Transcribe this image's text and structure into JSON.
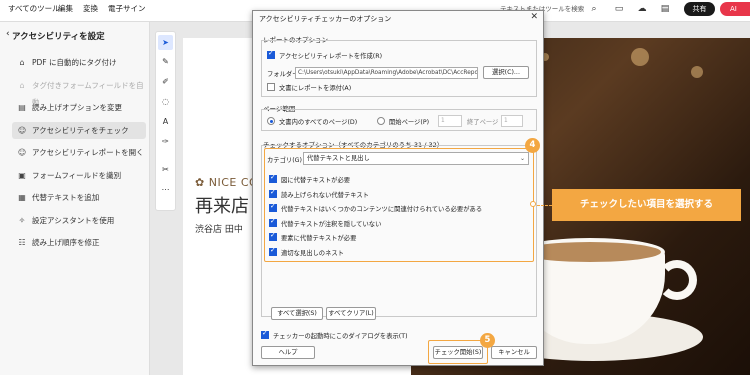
{
  "topbar": {
    "menus": [
      "すべてのツール",
      "編集",
      "変換",
      "電子サイン"
    ],
    "search_placeholder": "テキストまたはツールを検索",
    "share_label": "共有",
    "ai_label": "AI"
  },
  "leftpanel": {
    "title": "アクセシビリティを設定",
    "items": [
      {
        "label": "PDF に自動的にタグ付け",
        "icon": "tag-icon",
        "glyph": "⌂",
        "disabled": false,
        "active": false
      },
      {
        "label": "タグ付きフォームフィールドを自動",
        "icon": "form-tag-icon",
        "glyph": "⌂",
        "disabled": true,
        "active": false
      },
      {
        "label": "読み上げオプションを変更",
        "icon": "read-aloud-icon",
        "glyph": "▤",
        "disabled": false,
        "active": false
      },
      {
        "label": "アクセシビリティをチェック",
        "icon": "accessibility-check-icon",
        "glyph": "☺",
        "disabled": false,
        "active": true
      },
      {
        "label": "アクセシビリティレポートを開く",
        "icon": "report-icon",
        "glyph": "☺",
        "disabled": false,
        "active": false
      },
      {
        "label": "フォームフィールドを識別",
        "icon": "form-field-icon",
        "glyph": "▣",
        "disabled": false,
        "active": false
      },
      {
        "label": "代替テキストを追加",
        "icon": "alt-text-icon",
        "glyph": "▦",
        "disabled": false,
        "active": false
      },
      {
        "label": "設定アシスタントを使用",
        "icon": "wizard-icon",
        "glyph": "✧",
        "disabled": false,
        "active": false
      },
      {
        "label": "読み上げ順序を修正",
        "icon": "reading-order-icon",
        "glyph": "☷",
        "disabled": false,
        "active": false
      }
    ]
  },
  "document": {
    "brand": "NICE CO",
    "title": "再来店",
    "subline": "渋谷店 田中"
  },
  "dialog": {
    "title": "アクセシビリティチェッカーのオプション",
    "report_section": "レポートのオプション",
    "create_report_label": "アクセシビリティレポートを作成(R)",
    "folder_label": "フォルダー：",
    "folder_path": "C:\\Users\\otsuki\\AppData\\Roaming\\Adobe\\Acrobat\\DC\\AccRepo",
    "choose_button": "選択(C)...",
    "attach_report_label": "文書にレポートを添付(A)",
    "page_range_section": "ページ範囲",
    "all_pages_label": "文書内のすべてのページ(D)",
    "start_page_label": "開始ページ(P)",
    "start_page_value": "1",
    "end_page_label": "終了ページ",
    "end_page_value": "1",
    "check_options_section": "チェックするオプション（すべてのカテゴリのうち 31 / 32）",
    "category_label": "カテゴリ(G)：",
    "category_value": "代替テキストと見出し",
    "check_items": [
      "図に代替テキストが必要",
      "読み上げられない代替テキスト",
      "代替テキストはいくつかのコンテンツに関連付けられている必要がある",
      "代替テキストが注釈を隠していない",
      "要素に代替テキストが必要",
      "適切な見出しのネスト"
    ],
    "select_all_button": "すべて選択(S)",
    "clear_all_button": "すべてクリア(L)",
    "show_dialog_label": "チェッカーの起動時にこのダイアログを表示(T)",
    "help_button": "ヘルプ",
    "start_check_button": "チェック開始(S)",
    "cancel_button": "キャンセル"
  },
  "annotations": {
    "step4": "4",
    "step5": "5",
    "callout": "チェックしたい項目を選択する",
    "accent": "#f3a742"
  }
}
